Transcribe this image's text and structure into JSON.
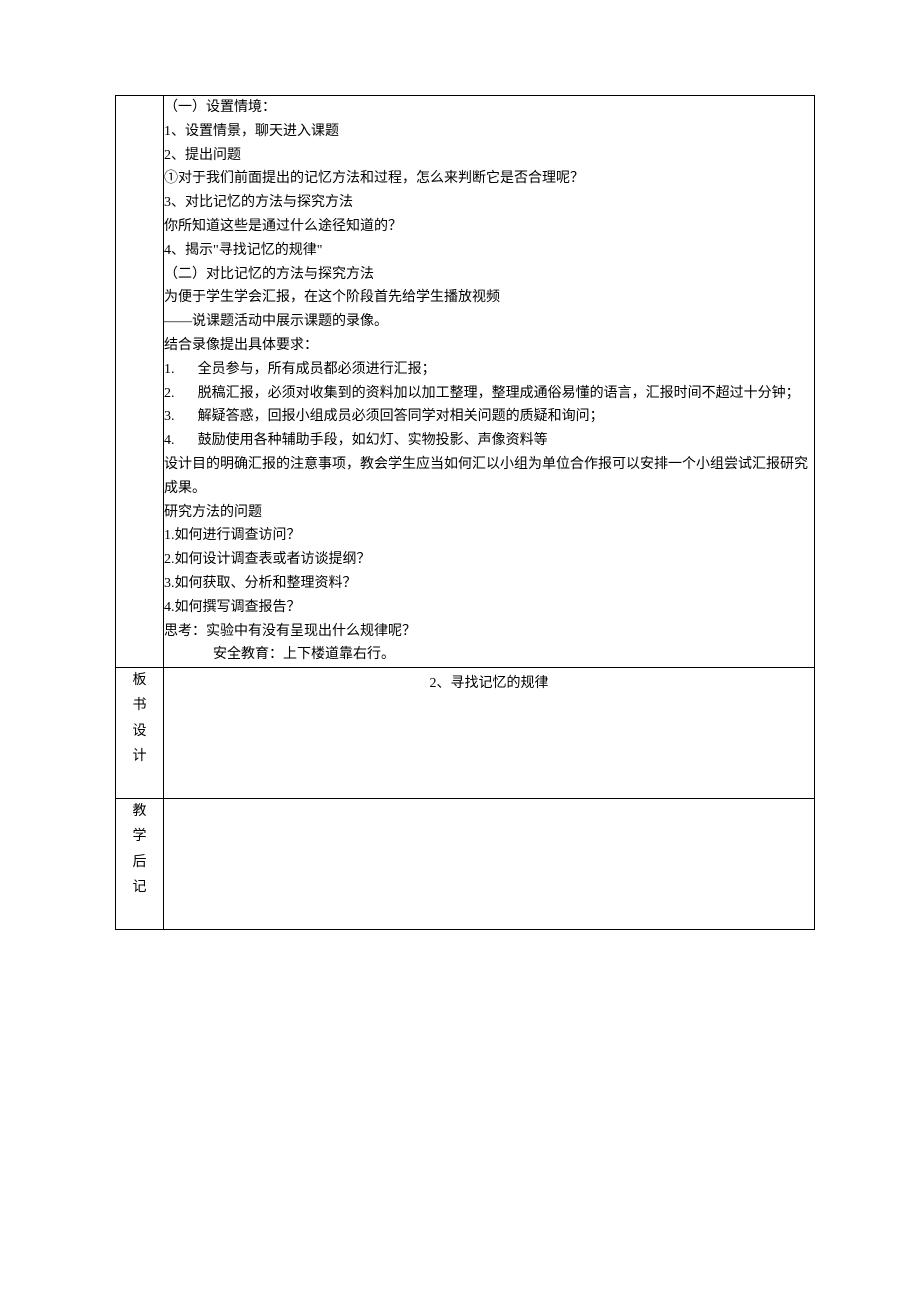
{
  "row1": {
    "s1_title": "（一）设置情境：",
    "item1": "1、设置情景，聊天进入课题",
    "item2": "2、提出问题",
    "q1": "①对于我们前面提出的记忆方法和过程，怎么来判断它是否合理呢？",
    "item3": "3、对比记忆的方法与探究方法",
    "q3": "你所知道这些是通过什么途径知道的？",
    "item4": "4、揭示\"寻找记忆的规律\"",
    "s2_title": "（二）对比记忆的方法与探究方法",
    "s2_l1": "为便于学生学会汇报，在这个阶段首先给学生播放视频",
    "s2_l2": "——说课题活动中展示课题的录像。",
    "s2_l3": "结合录像提出具体要求：",
    "ol": [
      "全员参与，所有成员都必须进行汇报；",
      "脱稿汇报，必须对收集到的资料加以加工整理，整理成通俗易懂的语言，汇报时间不超过十分钟；",
      "解疑答惑，回报小组成员必须回答同学对相关问题的质疑和询问；",
      "鼓励使用各种辅助手段，如幻灯、实物投影、声像资料等"
    ],
    "s2_l4": "设计目的明确汇报的注意事项，教会学生应当如何汇以小组为单位合作报可以安排一个小组尝试汇报研究成果。",
    "rm_title": "研究方法的问题",
    "rm1": "1.如何进行调查访问？",
    "rm2": "2.如何设计调查表或者访谈提纲？",
    "rm3": "3.如何获取、分析和整理资料？",
    "rm4": "4.如何撰写调查报告？",
    "think": "思考：实验中有没有呈现出什么规律呢？",
    "safety": "安全教育：上下楼道靠右行。"
  },
  "row2": {
    "label_chars": [
      "板",
      "书",
      "设",
      "计"
    ],
    "title": "2、寻找记忆的规律"
  },
  "row3": {
    "label_chars": [
      "教",
      "学",
      "后",
      "记"
    ]
  }
}
